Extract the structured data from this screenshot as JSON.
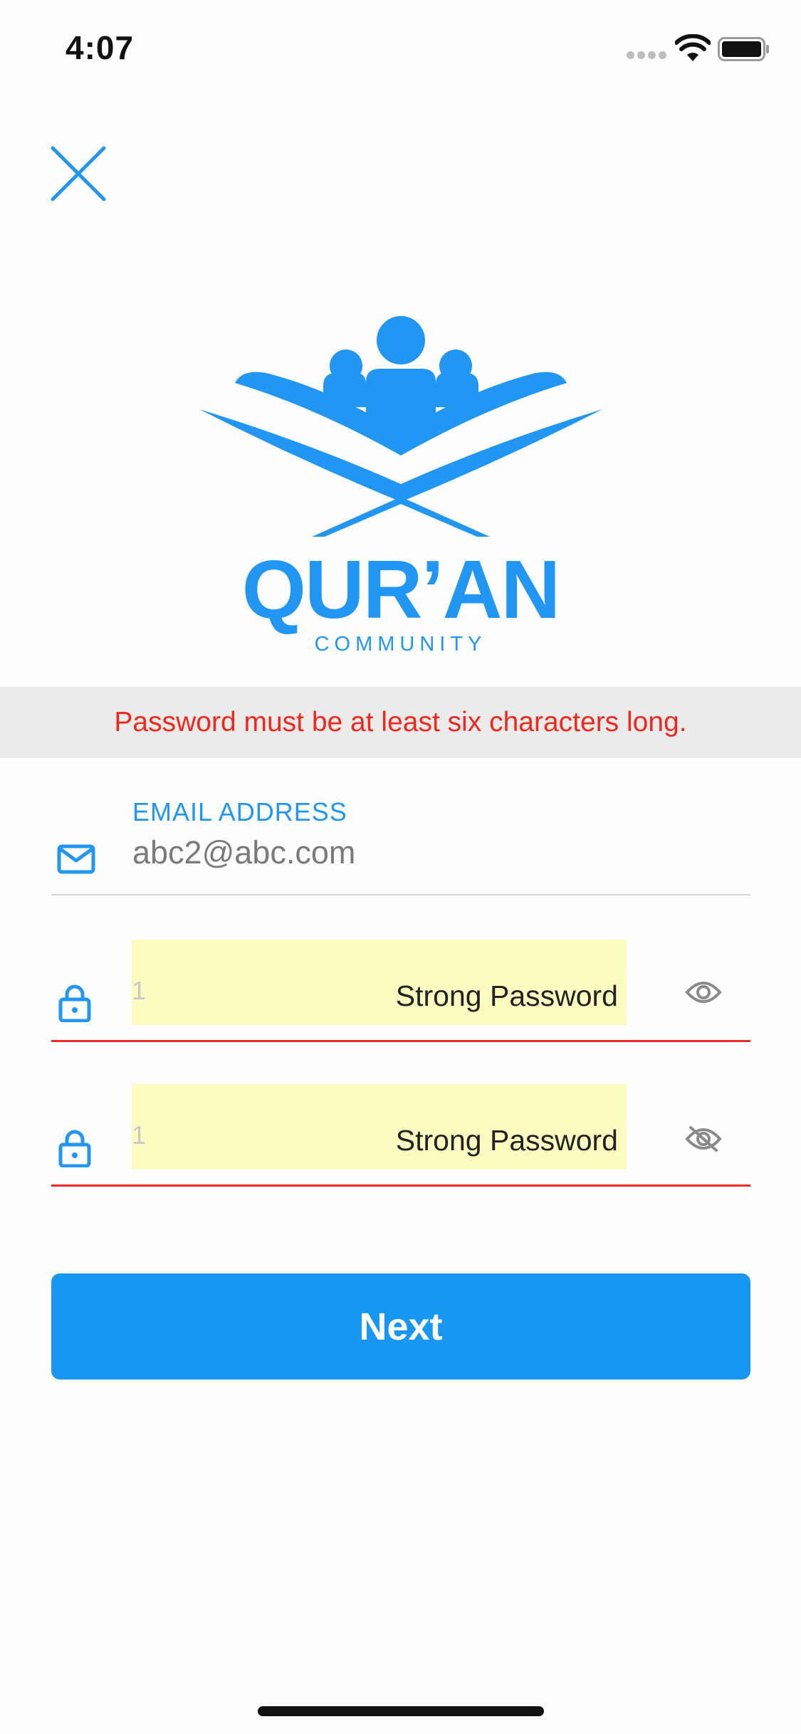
{
  "status_bar": {
    "time": "4:07"
  },
  "icons": {
    "close": "close-icon",
    "mail": "mail-icon",
    "lock": "lock-icon",
    "eye": "eye-icon",
    "eye_off": "eye-off-icon",
    "wifi": "wifi-icon",
    "battery": "battery-icon",
    "signal": "signal-icon"
  },
  "logo": {
    "title": "QUR’AN",
    "subtitle": "COMMUNITY"
  },
  "error": {
    "message": "Password must be at least six characters long."
  },
  "email": {
    "label": "EMAIL ADDRESS",
    "value": "abc2@abc.com"
  },
  "password": {
    "value": "1",
    "strength": "Strong Password"
  },
  "confirm_password": {
    "value": "1",
    "strength": "Strong Password"
  },
  "actions": {
    "next_label": "Next"
  },
  "colors": {
    "accent": "#2196f3",
    "button": "#1797f2",
    "error": "#f0271c",
    "banner_bg": "#ebebeb",
    "autofill_bg": "#fbfdc0"
  }
}
